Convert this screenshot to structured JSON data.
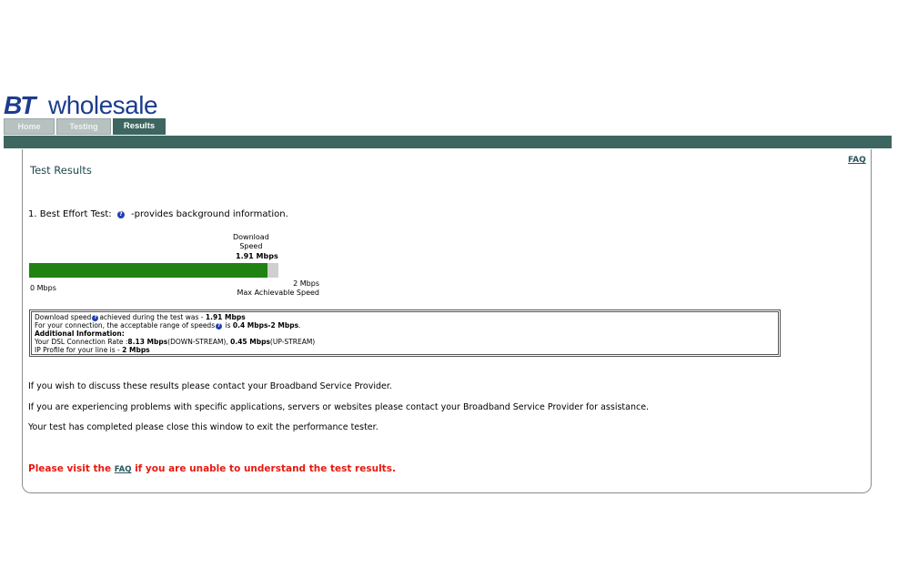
{
  "brand": {
    "bt": "BT",
    "wholesale": "wholesale",
    "color": "#1d3c8f"
  },
  "tabs": [
    {
      "label": "Home",
      "active": false
    },
    {
      "label": "Testing",
      "active": false
    },
    {
      "label": "Results",
      "active": true
    }
  ],
  "header": {
    "faq_link": "FAQ"
  },
  "page": {
    "title": "Test Results"
  },
  "section": {
    "heading": "1. Best Effort Test:",
    "help_note": "-provides background information."
  },
  "gauge": {
    "download_label_line1": "Download",
    "download_label_line2": "Speed",
    "download_value": "1.91 Mbps",
    "min_label": "0 Mbps",
    "max_value": "2 Mbps",
    "max_label": "Max Achievable Speed",
    "fill_fraction": 0.955,
    "fill_color": "#1f8211"
  },
  "info": {
    "line1_prefix": "Download speed",
    "line1_middle": "achieved during the test was - ",
    "line1_value": "1.91 Mbps",
    "line2_prefix": "For your connection, the acceptable range of speeds",
    "line2_middle": " is ",
    "line2_value": "0.4 Mbps-2 Mbps",
    "line2_suffix": ".",
    "additional_heading": "Additional Information:",
    "line4_prefix": "Your DSL Connection Rate :",
    "downstream_value": "8.13 Mbps",
    "downstream_label": "(DOWN-STREAM), ",
    "upstream_value": "0.45 Mbps",
    "upstream_label": "(UP-STREAM)",
    "line5_prefix": "IP Profile for your line is - ",
    "line5_value": "2 Mbps"
  },
  "paragraphs": [
    "If you wish to discuss these results please contact your Broadband Service Provider.",
    "If you are experiencing problems with specific applications, servers or websites please contact your Broadband Service Provider for assistance.",
    "Your test has completed please close this window to exit the performance tester."
  ],
  "alert": {
    "prefix": "Please visit the ",
    "link": "FAQ",
    "suffix": " if you are unable to understand the test results.",
    "color": "#e8190f"
  }
}
